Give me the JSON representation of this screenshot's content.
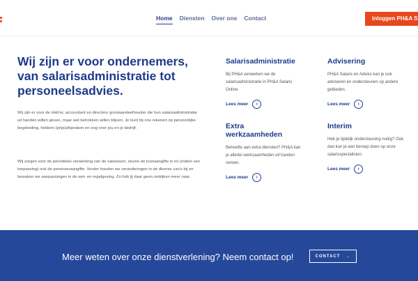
{
  "header": {
    "nav": [
      {
        "label": "Home"
      },
      {
        "label": "Diensten"
      },
      {
        "label": "Over ons"
      },
      {
        "label": "Contact"
      }
    ],
    "login_label": "Inloggen PH&A S"
  },
  "hero": {
    "title": "Wij zijn er voor ondernemers, van salarisadministratie tot personeelsadvies.",
    "paragraph1": "Wij zijn er voor de mkb'er, accountant en directeur grootaandeelhouder die hun salarisadministratie uit handen willen geven, maar wel betrokken willen blijven. Je kunt bij ons rekenen op persoonlijke begeleiding, heldere (prijs)afspraken en oog voor jou en je bedrijf.",
    "paragraph2": "Wij zorgen voor de periodieke verwerking van de salarissen, sturen de loonaangifte in en (indien van toepassing) ook de pensioenaangifte. Verder houden we veranderingen in de diverse cao's bij en bewaken we aanpassingen in de wet- en regelgeving. Zo heb jij daar geen omkijken meer naar."
  },
  "services": {
    "more_label": "Lees meer",
    "arrow": "›",
    "items": [
      {
        "title": "Salarisadministratie",
        "text": "Bij PH&A verwerken we de salarisadministratie in PH&A Salaris Online."
      },
      {
        "title": "Advisering",
        "text": "PH&A Salaris en Advies kan je ook adviseren en ondersteunen op andere gebieden."
      },
      {
        "title": "Extra werkzaamheden",
        "text": "Behoefte aan extra diensten? PH&A kan je allerlei werkzaamheden uit handen nemen."
      },
      {
        "title": "Interim",
        "text": "Heb je tijdelijk ondersteuning nodig? Ook dan kun je een beroep doen op onze salarisspecialisten."
      }
    ]
  },
  "cta": {
    "text": "Meer weten over onze dienstverlening? Neem contact op!",
    "button_label": "CONTACT",
    "button_arrow": "→"
  },
  "colors": {
    "brand_blue": "#1e3a8a",
    "accent_orange": "#e8461c",
    "cta_background": "#26489a"
  }
}
